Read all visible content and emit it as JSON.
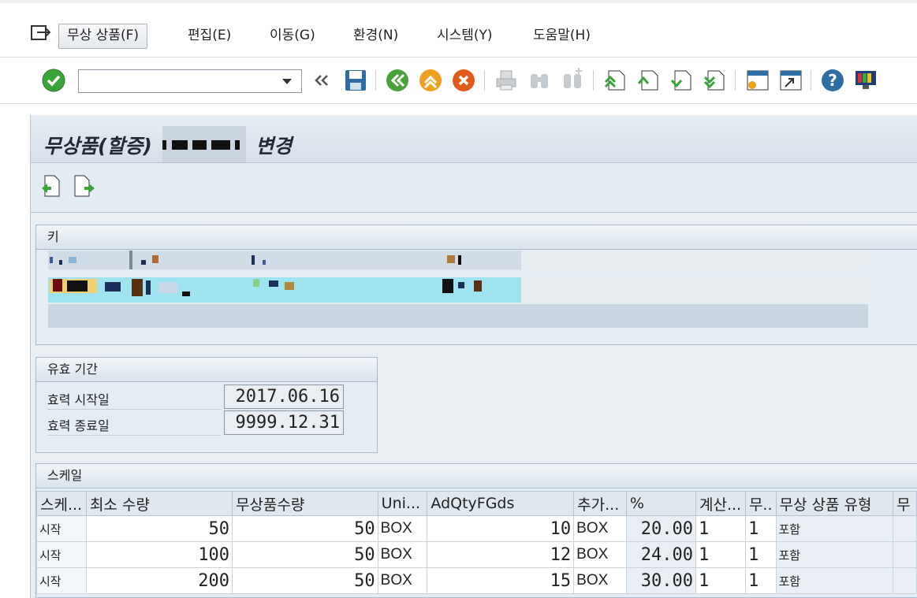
{
  "menubar": {
    "items": [
      {
        "label": "무상 상품(F)"
      },
      {
        "label": "편집(E)"
      },
      {
        "label": "이동(G)"
      },
      {
        "label": "환경(N)"
      },
      {
        "label": "시스템(Y)"
      },
      {
        "label": "도움말(H)"
      }
    ]
  },
  "toolbar": {
    "command_field": {
      "value": ""
    },
    "icons": [
      "enter-check-icon",
      "command-dropdown-icon",
      "collapse-icon",
      "save-icon",
      "back-icon",
      "exit-icon",
      "cancel-icon",
      "print-icon",
      "find-icon",
      "find-next-icon",
      "first-page-icon",
      "previous-page-icon",
      "next-page-icon",
      "last-page-icon",
      "new-session-icon",
      "shortcut-icon",
      "help-icon",
      "customize-layout-icon"
    ]
  },
  "header": {
    "title_prefix": "무상품(할증)",
    "title_suffix": "변경"
  },
  "key_group": {
    "title": "키"
  },
  "validity": {
    "title": "유효 기간",
    "start_label": "효력 시작일",
    "start_value": "2017.06.16",
    "end_label": "효력 종료일",
    "end_value": "9999.12.31"
  },
  "scale": {
    "title": "스케일",
    "columns": [
      "스케...",
      "최소 수량",
      "무상품수량",
      "Uni...",
      "AdQtyFGds",
      "추가...",
      "%",
      "계산...",
      "무..",
      "무상 상품 유형",
      "무"
    ],
    "rows": [
      {
        "scale": "시작",
        "min_qty": "50",
        "free_qty": "50",
        "unit": "BOX",
        "add_qty": "10",
        "add_unit": "BOX",
        "pct": "20.00",
        "calc": "1",
        "free_flag": "1",
        "type": "포함"
      },
      {
        "scale": "시작",
        "min_qty": "100",
        "free_qty": "50",
        "unit": "BOX",
        "add_qty": "12",
        "add_unit": "BOX",
        "pct": "24.00",
        "calc": "1",
        "free_flag": "1",
        "type": "포함"
      },
      {
        "scale": "시작",
        "min_qty": "200",
        "free_qty": "50",
        "unit": "BOX",
        "add_qty": "15",
        "add_unit": "BOX",
        "pct": "30.00",
        "calc": "1",
        "free_flag": "1",
        "type": "포함"
      }
    ]
  },
  "colors": {
    "accent": "#1f6fb2",
    "panel": "#e9eef3",
    "ok_green": "#3aa33a",
    "cancel_orange": "#e05a1a"
  }
}
